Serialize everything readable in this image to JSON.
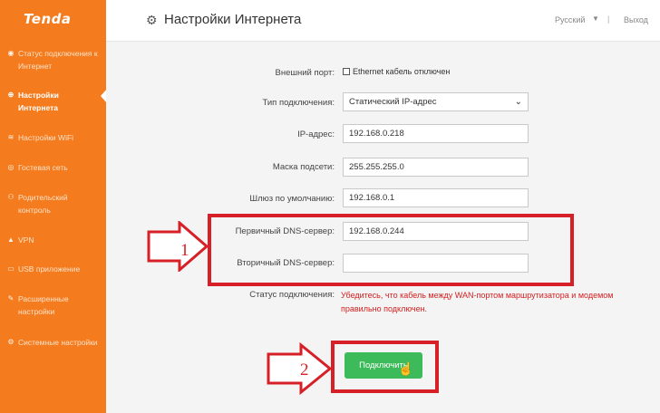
{
  "sidebar": {
    "logo": "Tenda",
    "items": [
      {
        "icon": "status-icon",
        "glyph": "◉",
        "label": "Статус подключения к Интернет",
        "active": false
      },
      {
        "icon": "globe-icon",
        "glyph": "⊕",
        "label": "Настройки Интернета",
        "active": true
      },
      {
        "icon": "wifi-icon",
        "glyph": "≋",
        "label": "Настройки WiFi",
        "active": false
      },
      {
        "icon": "guest-icon",
        "glyph": "◎",
        "label": "Гостевая сеть",
        "active": false
      },
      {
        "icon": "parental-icon",
        "glyph": "⚇",
        "label": "Родительский контроль",
        "active": false
      },
      {
        "icon": "vpn-icon",
        "glyph": "▲",
        "label": "VPN",
        "active": false
      },
      {
        "icon": "usb-icon",
        "glyph": "▭",
        "label": "USB приложение",
        "active": false
      },
      {
        "icon": "advanced-icon",
        "glyph": "✎",
        "label": "Расширенные настройки",
        "active": false
      },
      {
        "icon": "system-icon",
        "glyph": "⚙",
        "label": "Системные настройки",
        "active": false
      }
    ]
  },
  "header": {
    "title": "Настройки Интернета",
    "language": "Русский",
    "separator": "|",
    "logout": "Выход"
  },
  "form": {
    "wan_port_label": "Внешний порт:",
    "wan_port_status": "Ethernet кабель отключен",
    "connection_type_label": "Тип подключения:",
    "connection_type_value": "Статический IP-адрес",
    "ip_label": "IP-адрес:",
    "ip_value": "192.168.0.218",
    "mask_label": "Маска подсети:",
    "mask_value": "255.255.255.0",
    "gateway_label": "Шлюз по умолчанию:",
    "gateway_value": "192.168.0.1",
    "dns1_label": "Первичный DNS-сервер:",
    "dns1_value": "192.168.0.244",
    "dns2_label": "Вторичный DNS-сервер:",
    "dns2_value": "",
    "status_label": "Статус подключения:",
    "status_message": "Убедитесь, что кабель между WAN-портом маршрутизатора и модемом правильно подключен.",
    "connect_button": "Подключить"
  },
  "annotations": {
    "step1": "1",
    "step2": "2",
    "color": "#d61f26"
  },
  "colors": {
    "sidebar": "#f47c1f",
    "button": "#3dbb5a",
    "error_text": "#d42020"
  }
}
